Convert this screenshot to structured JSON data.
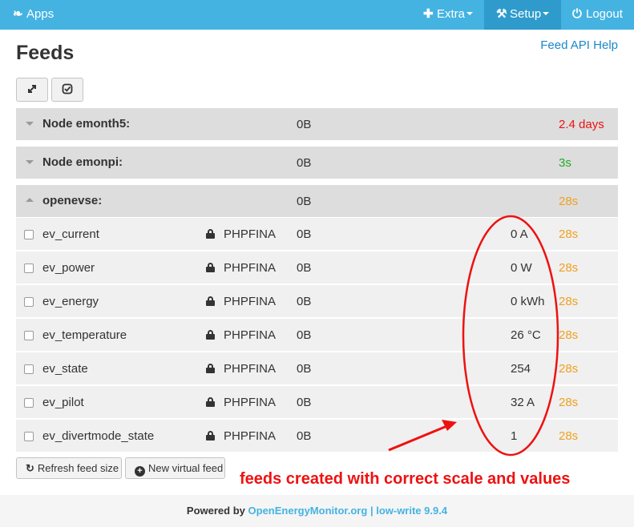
{
  "nav": {
    "apps_label": "Apps",
    "extra_label": "Extra",
    "setup_label": "Setup",
    "logout_label": "Logout",
    "brand_color": "#44b3e2",
    "active_color": "#2e9bcc"
  },
  "page": {
    "title": "Feeds",
    "api_help_label": "Feed API Help"
  },
  "toolbar": {
    "expand_icon": "expand-icon",
    "select_icon": "check-square-icon"
  },
  "nodes": [
    {
      "name": "Node emonth5:",
      "size": "0B",
      "time": "2.4 days",
      "time_color": "#ee1111",
      "expanded": false
    },
    {
      "name": "Node emonpi:",
      "size": "0B",
      "time": "3s",
      "time_color": "#22aa22",
      "expanded": false
    },
    {
      "name": "openevse:",
      "size": "0B",
      "time": "28s",
      "time_color": "#f0a020",
      "expanded": true
    }
  ],
  "feeds": [
    {
      "name": "ev_current",
      "engine": "PHPFINA",
      "size": "0B",
      "value": "0 A",
      "time": "28s"
    },
    {
      "name": "ev_power",
      "engine": "PHPFINA",
      "size": "0B",
      "value": "0 W",
      "time": "28s"
    },
    {
      "name": "ev_energy",
      "engine": "PHPFINA",
      "size": "0B",
      "value": "0 kWh",
      "time": "28s"
    },
    {
      "name": "ev_temperature",
      "engine": "PHPFINA",
      "size": "0B",
      "value": "26 °C",
      "time": "28s"
    },
    {
      "name": "ev_state",
      "engine": "PHPFINA",
      "size": "0B",
      "value": "254",
      "time": "28s"
    },
    {
      "name": "ev_pilot",
      "engine": "PHPFINA",
      "size": "0B",
      "value": "32 A",
      "time": "28s"
    },
    {
      "name": "ev_divertmode_state",
      "engine": "PHPFINA",
      "size": "0B",
      "value": "1",
      "time": "28s"
    }
  ],
  "feed_time_color": "#f0a020",
  "buttons": {
    "refresh_label": "Refresh feed size",
    "virtual_label": "New virtual feed"
  },
  "annotation": {
    "text": "feeds created with correct scale and values",
    "color": "#ee1111"
  },
  "footer": {
    "powered_by": "Powered by",
    "link_label": "OpenEnergyMonitor.org",
    "separator": "|",
    "version": "low-write 9.9.4"
  }
}
